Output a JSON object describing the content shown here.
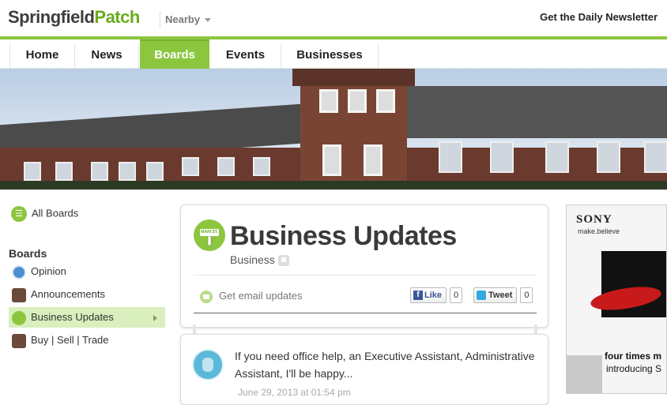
{
  "header": {
    "logo_city": "Springfield",
    "logo_patch": "Patch",
    "nearby_label": "Nearby",
    "newsletter_label": "Get the Daily Newsletter"
  },
  "nav": {
    "items": [
      {
        "label": "Home"
      },
      {
        "label": "News"
      },
      {
        "label": "Boards"
      },
      {
        "label": "Events"
      },
      {
        "label": "Businesses"
      }
    ],
    "active": "Boards",
    "accent_color": "#8cc63f"
  },
  "sidebar": {
    "all_boards_label": "All Boards",
    "heading": "Boards",
    "items": [
      {
        "label": "Opinion",
        "icon": "opinion-icon"
      },
      {
        "label": "Announcements",
        "icon": "announcements-thumb"
      },
      {
        "label": "Business Updates",
        "icon": "main-st-sign-icon",
        "active": true
      },
      {
        "label": "Buy | Sell | Trade",
        "icon": "buy-sell-thumb"
      }
    ]
  },
  "board": {
    "title": "Business Updates",
    "category": "Business",
    "badge_text": "MAIN ST.",
    "email_updates_label": "Get email updates",
    "like_label": "Like",
    "like_count": "0",
    "tweet_label": "Tweet",
    "tweet_count": "0"
  },
  "post": {
    "text": "If you need office help, an Executive Assistant, Administrative Assistant, I'll be happy...",
    "date": "June 29, 2013 at 01:54 pm"
  },
  "ad": {
    "brand": "SONY",
    "tagline": "make.believe",
    "line1": "four times m",
    "line2": "introducing S"
  }
}
